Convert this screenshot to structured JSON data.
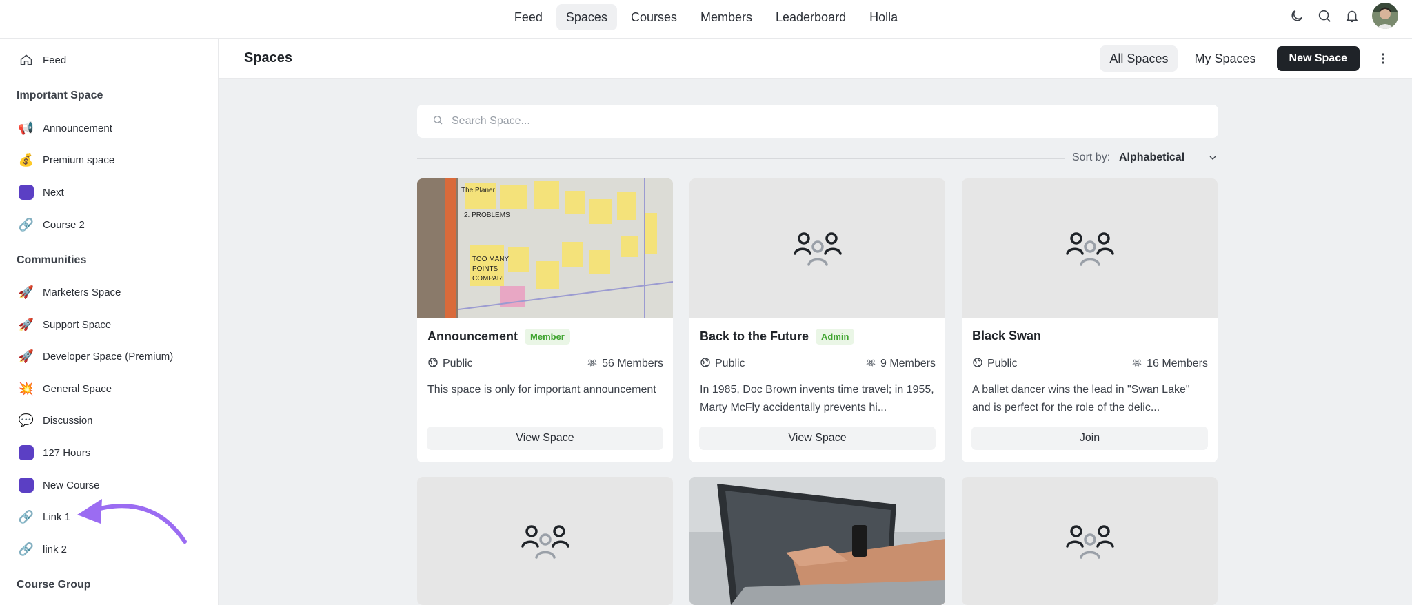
{
  "nav": {
    "items": [
      "Feed",
      "Spaces",
      "Courses",
      "Members",
      "Leaderboard",
      "Holla"
    ],
    "active": "Spaces"
  },
  "sidebar": {
    "feed": {
      "label": "Feed",
      "icon": "home-icon"
    },
    "groups": [
      {
        "title": "Important Space",
        "items": [
          {
            "label": "Announcement",
            "icon": "megaphone-icon"
          },
          {
            "label": "Premium space",
            "icon": "money-bag-icon"
          },
          {
            "label": "Next",
            "icon": "purple-square-icon"
          },
          {
            "label": "Course 2",
            "icon": "link-icon"
          }
        ]
      },
      {
        "title": "Communities",
        "items": [
          {
            "label": "Marketers Space",
            "icon": "rocket-icon"
          },
          {
            "label": "Support Space",
            "icon": "rocket-icon"
          },
          {
            "label": "Developer Space (Premium)",
            "icon": "rocket-icon"
          },
          {
            "label": "General Space",
            "icon": "collision-icon"
          },
          {
            "label": "Discussion",
            "icon": "speech-bubble-icon"
          },
          {
            "label": "127 Hours",
            "icon": "purple-square-icon"
          },
          {
            "label": "New Course",
            "icon": "purple-square-icon"
          },
          {
            "label": "Link 1",
            "icon": "link-icon"
          },
          {
            "label": "link 2",
            "icon": "link-icon"
          }
        ]
      },
      {
        "title": "Course Group",
        "items": []
      }
    ]
  },
  "header": {
    "title": "Spaces",
    "tabs": [
      "All Spaces",
      "My Spaces"
    ],
    "active_tab": "All Spaces",
    "new_button": "New Space"
  },
  "search": {
    "placeholder": "Search Space..."
  },
  "sort": {
    "label": "Sort by:",
    "value": "Alphabetical"
  },
  "cards": [
    {
      "title": "Announcement",
      "badge": "Member",
      "visibility": "Public",
      "members": "56 Members",
      "description": "This space is only for important announcement",
      "button": "View Space",
      "cover": "sticky-notes-photo"
    },
    {
      "title": "Back to the Future",
      "badge": "Admin",
      "visibility": "Public",
      "members": "9 Members",
      "description": "In 1985, Doc Brown invents time travel; in 1955, Marty McFly accidentally prevents hi...",
      "button": "View Space",
      "cover": "placeholder-group"
    },
    {
      "title": "Black Swan",
      "badge": "",
      "visibility": "Public",
      "members": "16 Members",
      "description": "A ballet dancer wins the lead in \"Swan Lake\" and is perfect for the role of the delic...",
      "button": "Join",
      "cover": "placeholder-group"
    },
    {
      "cover": "placeholder-group"
    },
    {
      "cover": "laptop-photo"
    },
    {
      "cover": "placeholder-group"
    }
  ],
  "colors": {
    "accent_purple": "#5b3fc4",
    "annotation_arrow": "#9b6cf2",
    "badge_green": "#41a531",
    "primary_dark": "#1f2328",
    "main_bg": "#eef0f2"
  }
}
